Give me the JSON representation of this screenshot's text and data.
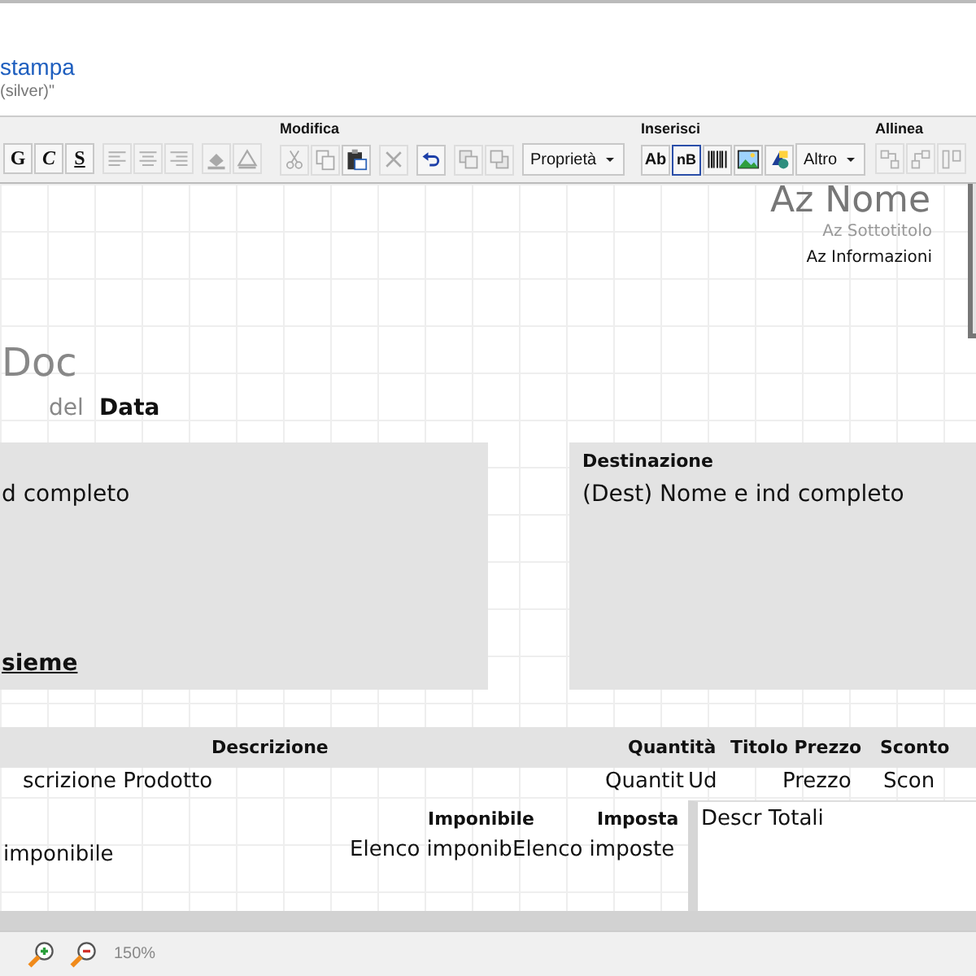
{
  "header": {
    "title": "stampa",
    "subtitle": "(silver)\""
  },
  "toolbar": {
    "groups": [
      {
        "items": [
          {
            "kind": "bold",
            "label": "G",
            "disabled": false
          },
          {
            "kind": "italic",
            "label": "C",
            "disabled": false
          },
          {
            "kind": "underline",
            "label": "S",
            "disabled": false
          },
          {
            "kind": "align-left",
            "disabled": true
          },
          {
            "kind": "align-center",
            "disabled": true
          },
          {
            "kind": "align-right",
            "disabled": true
          },
          {
            "kind": "fill",
            "disabled": true
          },
          {
            "kind": "border",
            "disabled": true
          }
        ]
      },
      {
        "label": "Modifica",
        "items": [
          {
            "kind": "cut",
            "disabled": true
          },
          {
            "kind": "copy",
            "disabled": true
          },
          {
            "kind": "paste",
            "disabled": false
          },
          {
            "kind": "delete",
            "disabled": true
          },
          {
            "kind": "undo",
            "disabled": false
          },
          {
            "kind": "front",
            "disabled": true
          },
          {
            "kind": "back",
            "disabled": true
          },
          {
            "kind": "dropdown",
            "label": "Proprietà",
            "disabled": false
          }
        ]
      },
      {
        "label": "Inserisci",
        "items": [
          {
            "kind": "text",
            "label": "Ab",
            "disabled": false
          },
          {
            "kind": "field",
            "label": "nB",
            "disabled": false
          },
          {
            "kind": "barcode",
            "disabled": false
          },
          {
            "kind": "image",
            "disabled": false
          },
          {
            "kind": "shapes",
            "disabled": false
          },
          {
            "kind": "dropdown",
            "label": "Altro",
            "disabled": false
          }
        ]
      },
      {
        "label": "Allinea",
        "items": [
          {
            "kind": "align-tops",
            "disabled": true
          },
          {
            "kind": "align-bottoms",
            "disabled": true
          },
          {
            "kind": "align-sides",
            "disabled": true
          }
        ]
      }
    ]
  },
  "report": {
    "company": {
      "name": "Az Nome",
      "subtitle": "Az Sottotitolo",
      "info": "Az Informazioni"
    },
    "document": {
      "title": "Doc",
      "date_prefix": "del",
      "date": "Data"
    },
    "sender": {
      "address": "d completo",
      "footer": "sieme"
    },
    "destination": {
      "label": "Destinazione",
      "address": "(Dest) Nome e ind completo"
    },
    "table": {
      "columns": [
        "Descrizione",
        "Quantità",
        "Titolo Prezzo",
        "Sconto"
      ],
      "row": [
        "scrizione Prodotto",
        "Quantit",
        "Ud",
        "Prezzo",
        "Scon"
      ]
    },
    "totals": {
      "taxable_label": "Imponibile",
      "tax_label": "Imposta",
      "taxable_text": "imponibile",
      "taxable_list": "Elenco imponib",
      "tax_list": "Elenco imposte",
      "description": "Descr Totali"
    }
  },
  "status_bar": {
    "zoom": "150%"
  }
}
